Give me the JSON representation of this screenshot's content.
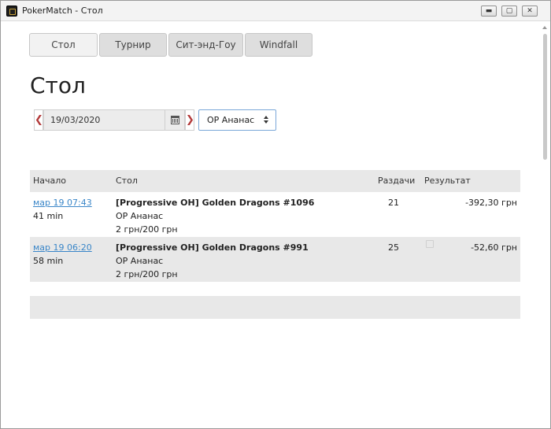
{
  "window": {
    "title": "PokerMatch - Стол",
    "controls": {
      "minimize": "▬",
      "maximize": "▢",
      "close": "✕"
    }
  },
  "tabs": [
    {
      "label": "Стол",
      "active": true
    },
    {
      "label": "Турнир",
      "active": false
    },
    {
      "label": "Сит-энд-Гоу",
      "active": false
    },
    {
      "label": "Windfall",
      "active": false
    }
  ],
  "page_title": "Стол",
  "filters": {
    "prev_arrow": "❮",
    "next_arrow": "❯",
    "date": "19/03/2020",
    "calendar_icon": "calendar-icon",
    "club_select": "OP Ананас"
  },
  "table": {
    "headers": {
      "start": "Начало",
      "table": "Стол",
      "hands": "Раздачи",
      "result": "Результат"
    },
    "rows": [
      {
        "time": "мар 19 07:43",
        "duration": "41 min",
        "table_name": "[Progressive OH] Golden Dragons #1096",
        "club": "OP Ананас",
        "stakes": "2 грн/200 грн",
        "hands": "21",
        "result": "-392,30 грн"
      },
      {
        "time": "мар 19 06:20",
        "duration": "58 min",
        "table_name": "[Progressive OH] Golden Dragons #991",
        "club": "OP Ананас",
        "stakes": "2 грн/200 грн",
        "hands": "25",
        "result": "-52,60 грн"
      }
    ]
  },
  "colors": {
    "link": "#3a86c8",
    "arrow": "#b33a3a",
    "row_alt": "#e8e8e8",
    "select_border": "#7aa7d8"
  }
}
